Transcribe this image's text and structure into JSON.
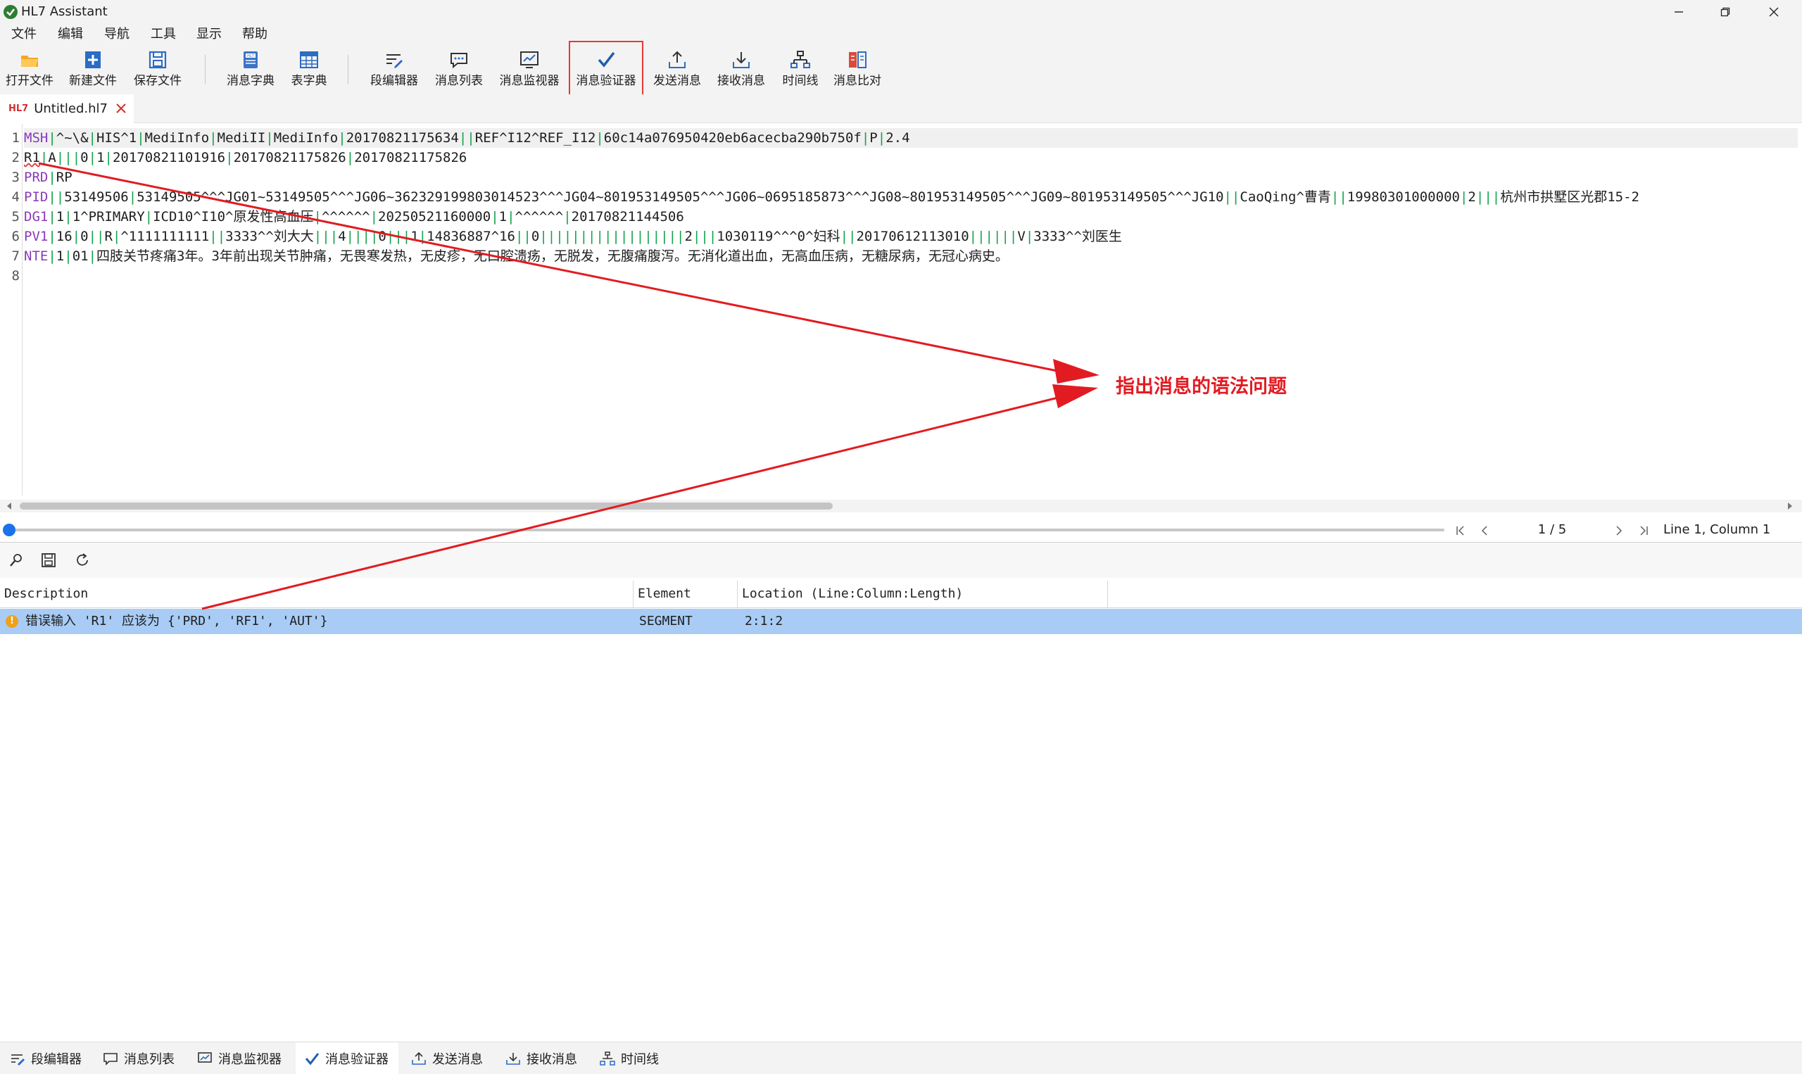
{
  "window": {
    "title": "HL7 Assistant",
    "icons": [
      "app-logo-icon",
      "minimize-icon",
      "maximize-icon",
      "close-icon"
    ]
  },
  "menu": [
    "文件",
    "编辑",
    "导航",
    "工具",
    "显示",
    "帮助"
  ],
  "toolbar": {
    "open_file": "打开文件",
    "new_file": "新建文件",
    "save_file": "保存文件",
    "message_dictionary": "消息字典",
    "table_dictionary": "表字典",
    "segment_editor": "段编辑器",
    "message_list": "消息列表",
    "message_monitor": "消息监视器",
    "message_validator": "消息验证器",
    "send_message": "发送消息",
    "receive_message": "接收消息",
    "timeline": "时间线",
    "message_compare": "消息比对"
  },
  "document_tab": {
    "badge": "HL7",
    "name": "Untitled.hl7"
  },
  "editor": {
    "lines": [
      {
        "no": "1",
        "seg": "MSH",
        "text": "|^~\\&|HIS^1|MediInfo|MediII|MediInfo|20170821175634||REF^I12^REF_I12|60c14a076950420eb6acecba290b750f|P|2.4"
      },
      {
        "no": "2",
        "seg": "R1",
        "text": "|A|||0|1|20170821101916|20170821175826|20170821175826"
      },
      {
        "no": "3",
        "seg": "PRD",
        "text": "|RP"
      },
      {
        "no": "4",
        "seg": "PID",
        "text": "||53149506|53149505^^^JG01~53149505^^^JG06~362329199803014523^^^JG04~801953149505^^^JG06~0695185873^^^JG08~801953149505^^^JG09~801953149505^^^JG10||CaoQing^曹青||19980301000000|2|||杭州市拱墅区光郡15-2"
      },
      {
        "no": "5",
        "seg": "DG1",
        "text": "|1|1^PRIMARY|ICD10^I10^原发性高血压|^^^^^^|20250521160000|1|^^^^^^|20170821144506"
      },
      {
        "no": "6",
        "seg": "PV1",
        "text": "|16|0||R|^1111111111||3333^^刘大大|||4||||0|||1|14836887^16||0||||||||||||||||||2|||1030119^^^0^妇科||20170612113010||||||V|3333^^刘医生"
      },
      {
        "no": "7",
        "seg": "NTE",
        "text": "|1|01|四肢关节疼痛3年。3年前出现关节肿痛，无畏寒发热，无皮疹，无口腔溃疡，无脱发，无腹痛腹泻。无消化道出血，无高血压病，无糖尿病，无冠心病史。"
      },
      {
        "no": "8",
        "seg": "",
        "text": ""
      }
    ]
  },
  "navigation": {
    "page": "1 / 5",
    "cursor": "Line 1, Column 1",
    "icons": [
      "first-page-icon",
      "prev-page-icon",
      "next-page-icon",
      "last-page-icon"
    ]
  },
  "panel": {
    "tool_icons": [
      "find-icon",
      "save-icon",
      "refresh-icon"
    ],
    "columns": [
      "Description",
      "Element",
      "Location (Line:Column:Length)"
    ],
    "rows": [
      {
        "description": "错误输入 'R1' 应该为 {'PRD', 'RF1', 'AUT'}",
        "element": "SEGMENT",
        "location": "2:1:2"
      }
    ]
  },
  "bottom_tabs": [
    "段编辑器",
    "消息列表",
    "消息监视器",
    "消息验证器",
    "发送消息",
    "接收消息",
    "时间线"
  ],
  "annotation": {
    "text": "指出消息的语法问题",
    "color": "#e21b22"
  },
  "colors": {
    "accent": "#1a73e8",
    "selection": "#a8ccf5",
    "segment": "#8a3ab9",
    "delimiter": "#13a34a",
    "warning": "#f0a01a",
    "highlight_border": "#e53935"
  }
}
